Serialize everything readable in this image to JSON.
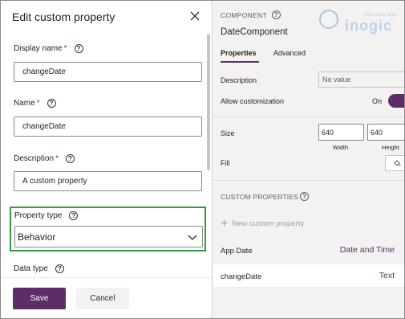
{
  "dialog": {
    "title": "Edit custom property",
    "fields": {
      "display_name": {
        "label": "Display name",
        "required": "*",
        "value": "changeDate"
      },
      "name": {
        "label": "Name",
        "required": "*",
        "value": "changeDate"
      },
      "description": {
        "label": "Description",
        "required": "*",
        "value": "A custom property"
      },
      "property_type": {
        "label": "Property type",
        "value": "Behavior"
      },
      "data_type": {
        "label": "Data type"
      }
    },
    "save_label": "Save",
    "cancel_label": "Cancel",
    "highlight_color": "#2ea043"
  },
  "panel": {
    "component_label": "COMPONENT",
    "component_name": "DateComponent",
    "tabs": [
      {
        "label": "Properties",
        "active": true
      },
      {
        "label": "Advanced",
        "active": false
      }
    ],
    "logo": {
      "text": "inogic",
      "tagline": "innovative logic"
    },
    "description_label": "Description",
    "description_placeholder": "No value",
    "allow_customization_label": "Allow customization",
    "toggle_state": "On",
    "size_label": "Size",
    "width_value": "640",
    "height_value": "640",
    "width_caption": "Width",
    "height_caption": "Height",
    "fill_label": "Fill",
    "custom_properties_title": "CUSTOM PROPERTIES",
    "new_custom_property": "New custom property",
    "custom_properties": [
      {
        "name": "App Date",
        "type": "Date and Time"
      },
      {
        "name": "changeDate",
        "type": "Text"
      }
    ],
    "accent_color": "#5c2d68"
  }
}
